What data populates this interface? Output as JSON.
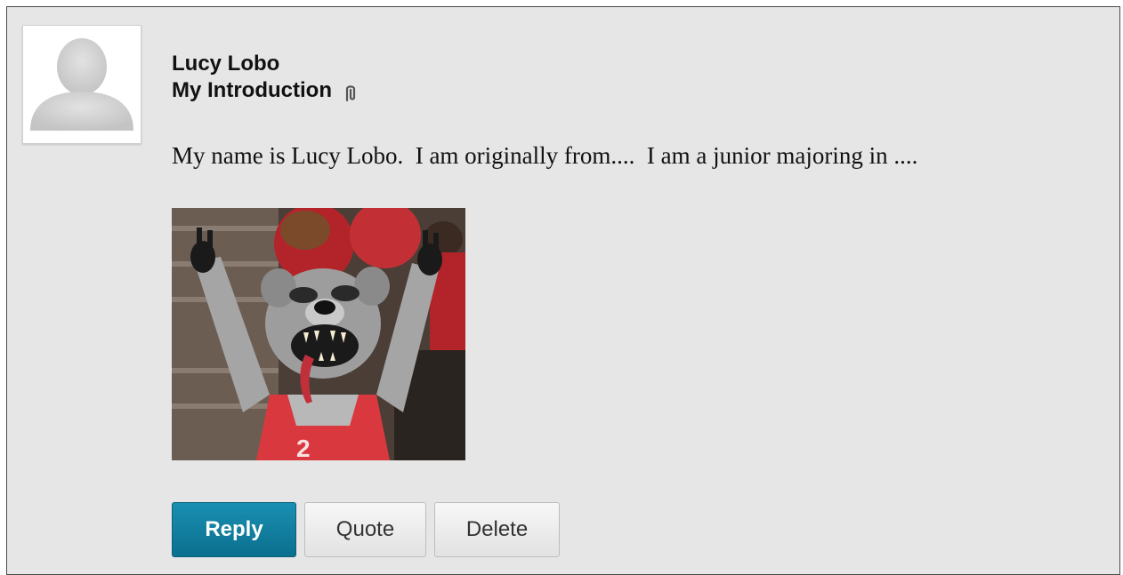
{
  "post": {
    "author": "Lucy Lobo",
    "subject": "My Introduction",
    "attachment_icon": "paperclip-icon",
    "body": "My name is Lucy Lobo.  I am originally from....  I am a junior majoring in ....",
    "avatar_icon": "default-user-silhouette-icon",
    "image_description_icon": "wolf-mascot-photo"
  },
  "actions": {
    "reply_label": "Reply",
    "quote_label": "Quote",
    "delete_label": "Delete"
  },
  "colors": {
    "background": "#e6e6e6",
    "reply_button": "#0b7da0",
    "border": "#4a4a4a"
  }
}
